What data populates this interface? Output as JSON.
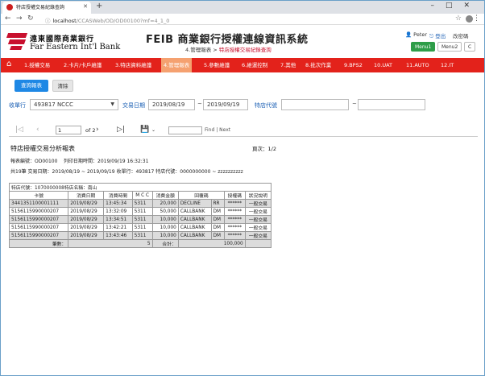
{
  "browser": {
    "tab_title": "特店授權交易紀錄查詢",
    "url_host": "localhost",
    "url_path": "/CCASWeb/OD/OD00100?mf=4_1_0"
  },
  "header": {
    "bank_name_zh": "遠東國際商業銀行",
    "bank_name_en": "Far Eastern Int'l Bank",
    "system_title": "FEIB 商業銀行授權連線資訊系統",
    "breadcrumb_parent": "4.管理報表 >",
    "breadcrumb_current": "特店授權交易紀錄查詢",
    "user_name": "Peter",
    "logout_label": "登出",
    "change_password_label": "改密碼",
    "menu_buttons": [
      "Menu1",
      "Menu2",
      "C"
    ]
  },
  "menu": {
    "items": [
      "1.授權交易",
      "2.卡片/卡戶維護",
      "3.特店資料維護",
      "4.管理報表",
      "5.參數維護",
      "6.維運控制",
      "7.其他",
      "8.批次作業",
      "9.BPS2",
      "10.UAT",
      "11.AUTO",
      "12.IT"
    ]
  },
  "toolbar": {
    "query_label": "查詢報表",
    "clear_label": "清除"
  },
  "filters": {
    "acq_bank_label": "收單行",
    "acq_bank_value": "493817 NCCC",
    "txn_date_label": "交易日期",
    "date_from": "2019/08/19",
    "date_sep": "~",
    "date_to": "2019/09/19",
    "merchant_label": "特店代號",
    "merchant_sep": "~"
  },
  "viewer": {
    "page_value": "1",
    "of_pages": "of 2",
    "find_label": "Find | Next"
  },
  "report": {
    "title": "特店授權交易分析報表",
    "page_info": "頁次：1/2",
    "report_no": "報表編號：OD00100",
    "print_time": "列印日期時間：2019/09/19 16:32:31",
    "summary_line": "共19筆    交易日期：2019/08/19 ~ 2019/09/19    收單行：493817    特店代號：0000000000 ~ zzzzzzzzzz",
    "merchant_line": "特店代號：1070000008特店名稱：南山",
    "columns": [
      "卡號",
      "消費日期",
      "消費時間",
      "M C C",
      "消費金額",
      "回覆碼",
      "",
      "授權碼",
      "狀況說明"
    ],
    "rows": [
      [
        "3441351100001111",
        "2019/08/29",
        "13:45:34",
        "5311",
        "20,000",
        "DECLINE",
        "RR",
        "******",
        "一般交易"
      ],
      [
        "5156115990000207",
        "2019/08/29",
        "13:32:09",
        "5311",
        "50,000",
        "CALLBANK",
        "DM",
        "******",
        "一般交易"
      ],
      [
        "5156115990000207",
        "2019/08/29",
        "13:34:51",
        "5311",
        "10,000",
        "CALLBANK",
        "DM",
        "******",
        "一般交易"
      ],
      [
        "5156115990000207",
        "2019/08/29",
        "13:42:21",
        "5311",
        "10,000",
        "CALLBANK",
        "DM",
        "******",
        "一般交易"
      ],
      [
        "5156115990000207",
        "2019/08/29",
        "13:43:46",
        "5311",
        "10,000",
        "CALLBANK",
        "DM",
        "******",
        "一般交易"
      ]
    ],
    "count_label": "筆數：",
    "count_value": "5",
    "total_label": "合計：",
    "total_value": "100,000"
  }
}
